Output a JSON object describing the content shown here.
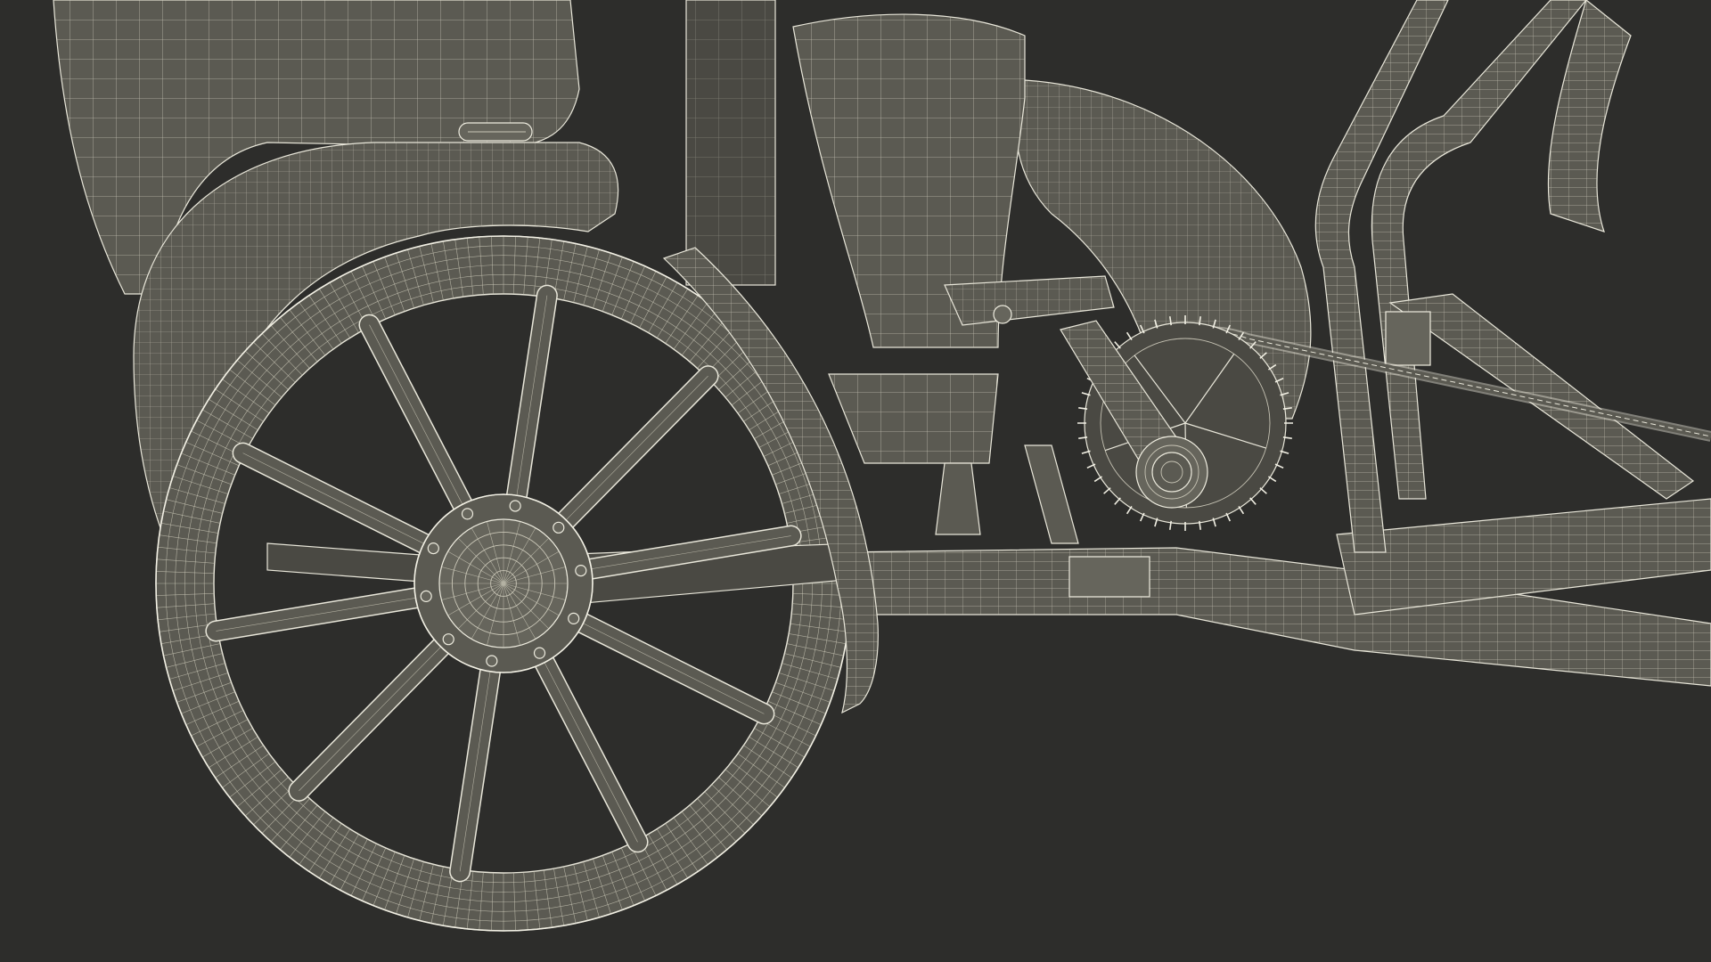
{
  "scene": {
    "subject": "",
    "background_color": "#2d2d2b",
    "mesh_fill": "#5b5a52",
    "wire_color": "#e9e7da",
    "wheel": {
      "spokes": 10
    },
    "chainring": {
      "teeth": 44
    }
  }
}
